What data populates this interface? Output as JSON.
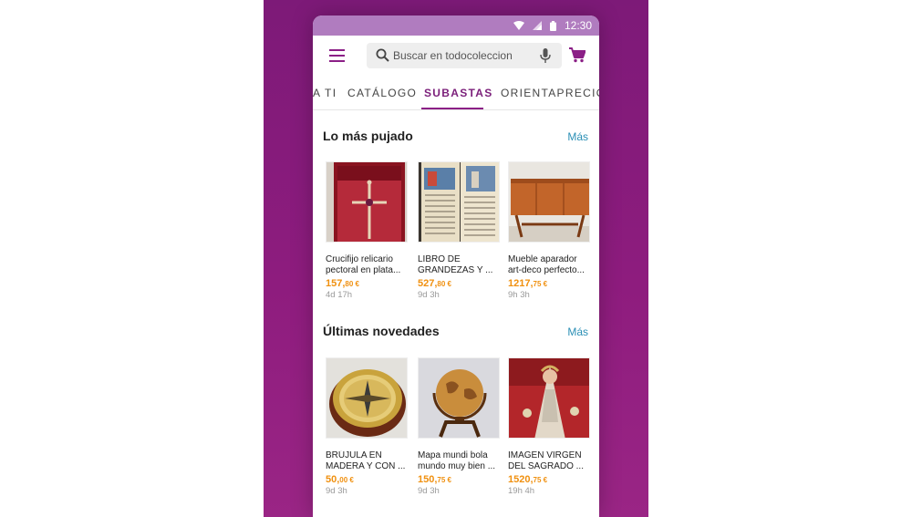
{
  "status_bar": {
    "time": "12:30"
  },
  "search": {
    "placeholder": "Buscar en todocoleccion"
  },
  "tabs": [
    {
      "label": "A TI"
    },
    {
      "label": "CATÁLOGO"
    },
    {
      "label": "SUBASTAS"
    },
    {
      "label": "ORIENTAPRECIOS"
    }
  ],
  "active_tab": "SUBASTAS",
  "colors": {
    "brand": "#8b1f86",
    "price": "#f0900f",
    "link": "#2a8fb5",
    "background": "#8e1c7e"
  },
  "sections": [
    {
      "title": "Lo más pujado",
      "more": "Más",
      "items": [
        {
          "title": "Crucifijo relicario pectoral en plata...",
          "price_main": "157,",
          "price_dec": "80 €",
          "time_left": "4d 17h",
          "image": "cross-reliquary"
        },
        {
          "title": "LIBRO DE GRANDEZAS Y ...",
          "price_main": "527,",
          "price_dec": "80 €",
          "time_left": "9d 3h",
          "image": "illuminated-book"
        },
        {
          "title": "Mueble aparador art-deco perfecto...",
          "price_main": "1217,",
          "price_dec": "75 €",
          "time_left": "9h 3h",
          "image": "sideboard"
        }
      ]
    },
    {
      "title": "Últimas novedades",
      "more": "Más",
      "items": [
        {
          "title": "BRÚJULA EN MADERA Y CON ...",
          "price_main": "50,",
          "price_dec": "00 €",
          "time_left": "9d 3h",
          "image": "compass"
        },
        {
          "title": "Mapa mundi bola mundo muy bien ...",
          "price_main": "150,",
          "price_dec": "75 €",
          "time_left": "9d 3h",
          "image": "globe"
        },
        {
          "title": "IMAGEN VIRGEN DEL SAGRADO ...",
          "price_main": "1520,",
          "price_dec": "75 €",
          "time_left": "19h 4h",
          "image": "virgin-statue"
        }
      ]
    }
  ]
}
